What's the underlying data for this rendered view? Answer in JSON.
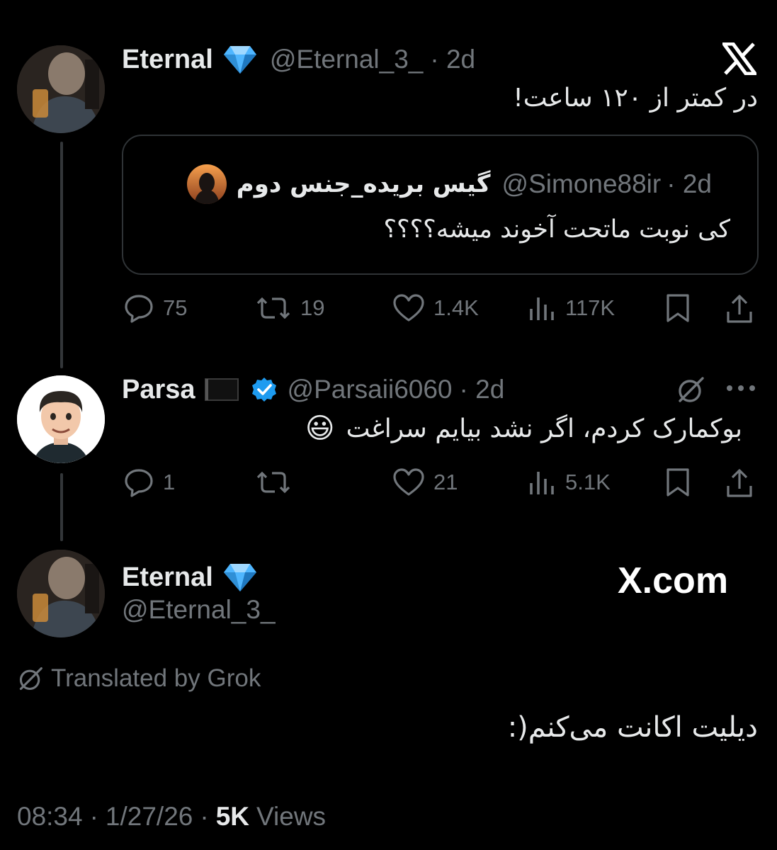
{
  "post1": {
    "name": "Eternal",
    "handle": "@Eternal_3_",
    "time": "· 2d",
    "text": "در کمتر از ۱۲۰ ساعت!",
    "quote": {
      "name": "گیس بریده_جنس دوم",
      "handle": "@Simone88ir",
      "time": "· 2d",
      "text": "کی نوبت ماتحت آخوند میشه؟؟؟؟"
    },
    "actions": {
      "replies": "75",
      "reposts": "19",
      "likes": "1.4K",
      "views": "117K"
    }
  },
  "post2": {
    "name": "Parsa",
    "handle": "@Parsaii6060",
    "time": "· 2d",
    "text": "بوکمارک کردم، اگر نشد بیایم سراغت",
    "emoji": "😃",
    "actions": {
      "replies": "1",
      "reposts": "",
      "likes": "21",
      "views": "5.1K"
    }
  },
  "post3": {
    "name": "Eternal",
    "handle": "@Eternal_3_",
    "translated_by": "Translated by Grok",
    "text": "دیلیت اکانت می‌کنم(:",
    "watermark": "X.com",
    "footer": {
      "time": "08:34",
      "date": "1/27/26",
      "views_count": "5K",
      "views_label": "Views"
    }
  },
  "icons": {
    "verified_diamond": "diamond-icon",
    "verified_badge": "blue-check-icon",
    "flag": "black-flag-icon",
    "grok": "grok-icon",
    "x_logo": "x-logo-icon"
  },
  "colors": {
    "background": "#000000",
    "text": "#e7e9ea",
    "muted": "#71767b",
    "verified": "#1d9bf0",
    "diamond": "#4fb6ff"
  }
}
